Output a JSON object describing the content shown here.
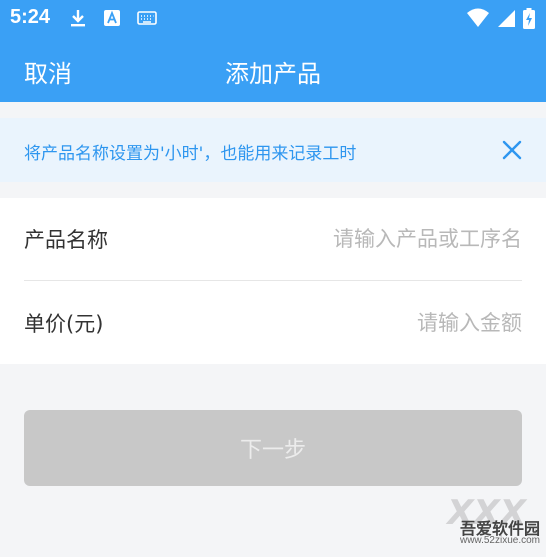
{
  "status_bar": {
    "time": "5:24"
  },
  "nav": {
    "cancel_label": "取消",
    "title": "添加产品"
  },
  "notice": {
    "text": "将产品名称设置为'小时'，也能用来记录工时"
  },
  "form": {
    "product_name": {
      "label": "产品名称",
      "placeholder": "请输入产品或工序名"
    },
    "unit_price": {
      "label": "单价(元)",
      "placeholder": "请输入金额"
    }
  },
  "next_button": {
    "label": "下一步"
  },
  "watermark": {
    "big_text": "XXX",
    "cn_text": "吾爱软件园",
    "url": "www.52zixue.com"
  },
  "colors": {
    "primary": "#3aa0f5",
    "notice_bg": "#eaf4fd",
    "disabled_btn": "#c8c8c8"
  }
}
